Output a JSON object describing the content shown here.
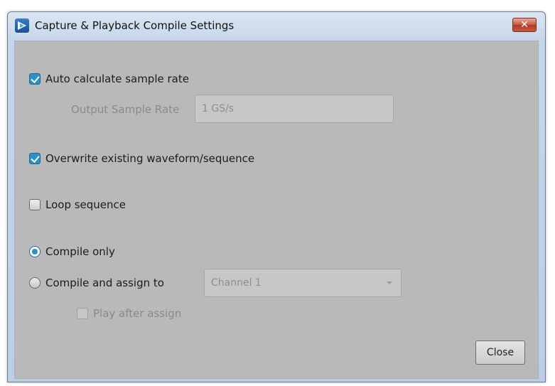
{
  "window": {
    "title": "Capture & Playback Compile Settings",
    "close_glyph": "✕"
  },
  "options": {
    "auto_calc": {
      "label": "Auto calculate sample rate",
      "checked": true
    },
    "output_sample_rate": {
      "label": "Output Sample Rate",
      "value": "1 GS/s",
      "enabled": false
    },
    "overwrite": {
      "label": "Overwrite existing waveform/sequence",
      "checked": true
    },
    "loop": {
      "label": "Loop sequence",
      "checked": false
    },
    "compile_only": {
      "label": "Compile only",
      "selected": true
    },
    "compile_assign": {
      "label": "Compile and assign to",
      "selected": false
    },
    "channel_select": {
      "value": "Channel 1",
      "enabled": false
    },
    "play_after": {
      "label": "Play after assign",
      "checked": false,
      "enabled": false
    }
  },
  "footer": {
    "close_label": "Close"
  },
  "colors": {
    "accent": "#2e8fc5",
    "dialog_bg": "#b9b9b9",
    "titlebar": "#c6d6ea",
    "close_red": "#c75a45"
  },
  "icons": {
    "app": "app-logo-icon",
    "window_close": "close-icon",
    "dropdown": "chevron-down-icon"
  }
}
